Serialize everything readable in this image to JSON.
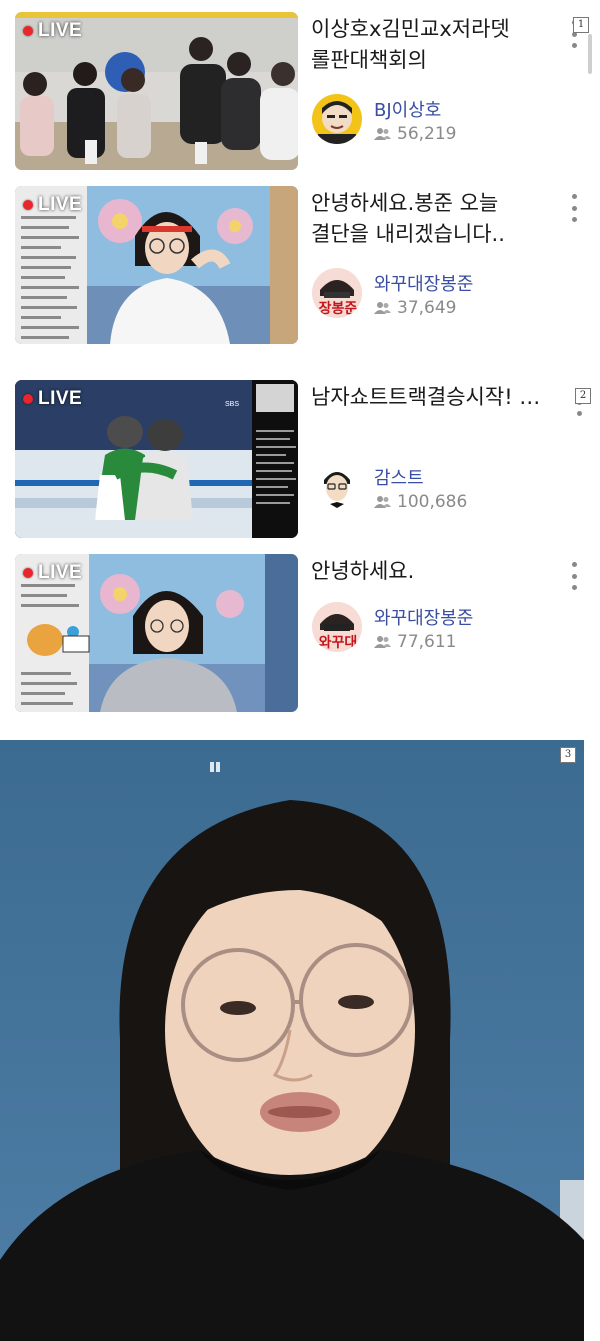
{
  "live_label": "LIVE",
  "annotations": [
    "1",
    "2",
    "3"
  ],
  "streams": [
    {
      "title": "이상호x김민교x저라뎃 롤판대책회의",
      "channel": "BJ이상호",
      "viewers": "56,219",
      "avatar_text": ""
    },
    {
      "title": "안녕하세요.봉준 오늘 결단을 내리겠습니다..",
      "channel": "와꾸대장봉준",
      "viewers": "37,649",
      "avatar_text": "장봉준"
    },
    {
      "title": "남자쇼트트랙결승시작! 황대헌,이준서,박장혁…",
      "channel": "감스트",
      "viewers": "100,686",
      "avatar_text": ""
    },
    {
      "title": "안녕하세요.",
      "channel": "와꾸대장봉준",
      "viewers": "77,611",
      "avatar_text": "와꾸대"
    }
  ],
  "thumb_overlays": {
    "sbs_badge": "SBS"
  },
  "colors": {
    "live_dot": "#e8262c",
    "channel_name": "#3a4ea3",
    "viewer_count": "#8a8a8a"
  },
  "icons": {
    "viewers": "people-icon",
    "more": "kebab-menu-icon"
  }
}
